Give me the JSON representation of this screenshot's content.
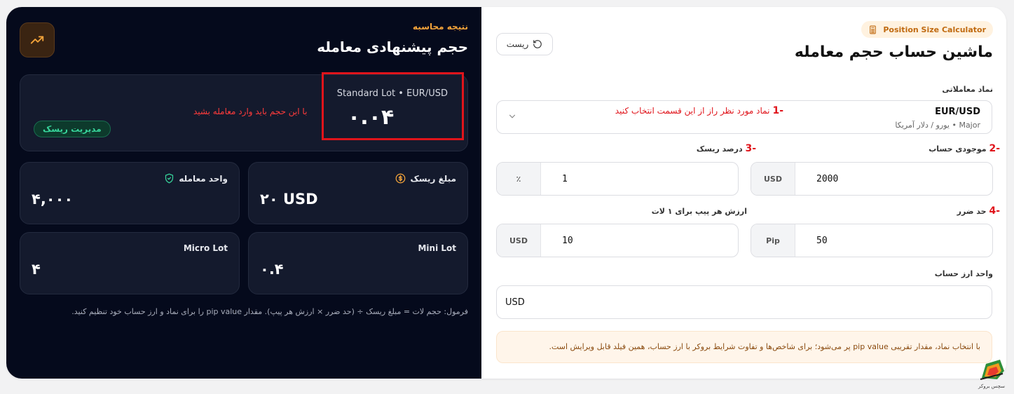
{
  "result": {
    "subtitle": "نتیجه محاسبه",
    "title": "حجم پیشنهادی معامله",
    "risk_badge": "مدیریت ریسک",
    "annotation": "با این حجم باید وارد معامله بشید",
    "lot_type": "Standard Lot",
    "symbol": "EUR/USD",
    "lot_value": "۰.۰۴",
    "stats": {
      "risk_amount_label": "مبلغ ریسک",
      "risk_amount_value": "۲۰ USD",
      "trade_units_label": "واحد معامله",
      "trade_units_value": "۴,۰۰۰",
      "mini_lot_label": "Mini Lot",
      "mini_lot_value": "۰.۴",
      "micro_lot_label": "Micro Lot",
      "micro_lot_value": "۴"
    },
    "formula": "فرمول: حجم لات = مبلغ ریسک ÷ (حد ضرر × ارزش هر پیپ). مقدار pip value را برای نماد و ارز حساب خود تنظیم کنید."
  },
  "calculator": {
    "badge": "Position Size Calculator",
    "title": "ماشین حساب حجم معامله",
    "reset_label": "ریست",
    "symbol_label": "نماد معاملاتی",
    "symbol_name": "EUR/USD",
    "symbol_desc": "Major • یورو / دلار آمریکا",
    "symbol_hint_num": "-1",
    "symbol_hint": "نماد مورد نظر راز از این قسمت انتخاب کنید",
    "balance_num": "-2",
    "balance_label": "موجودی حساب",
    "balance_unit": "USD",
    "balance_value": "2000",
    "risk_num": "-3",
    "risk_label": "درصد ریسک",
    "risk_unit": "٪",
    "risk_value": "1",
    "stop_num": "-4",
    "stop_label": "حد ضرر",
    "stop_unit": "Pip",
    "stop_value": "50",
    "pip_label": "ارزش هر پیپ برای ۱ لات",
    "pip_unit": "USD",
    "pip_value": "10",
    "currency_label": "واحد ارز حساب",
    "currency_value": "USD",
    "info": "با انتخاب نماد، مقدار تقریبی pip value پر می‌شود؛ برای شاخص‌ها و تفاوت شرایط بروکر با ارز حساب، همین فیلد قابل ویرایش است."
  },
  "logo_text": "سچس بروکر",
  "colors": {
    "dark_bg": "#050a1c",
    "accent": "#f4a43a",
    "highlight": "#e0141b",
    "badge_green": "#37d39a"
  }
}
